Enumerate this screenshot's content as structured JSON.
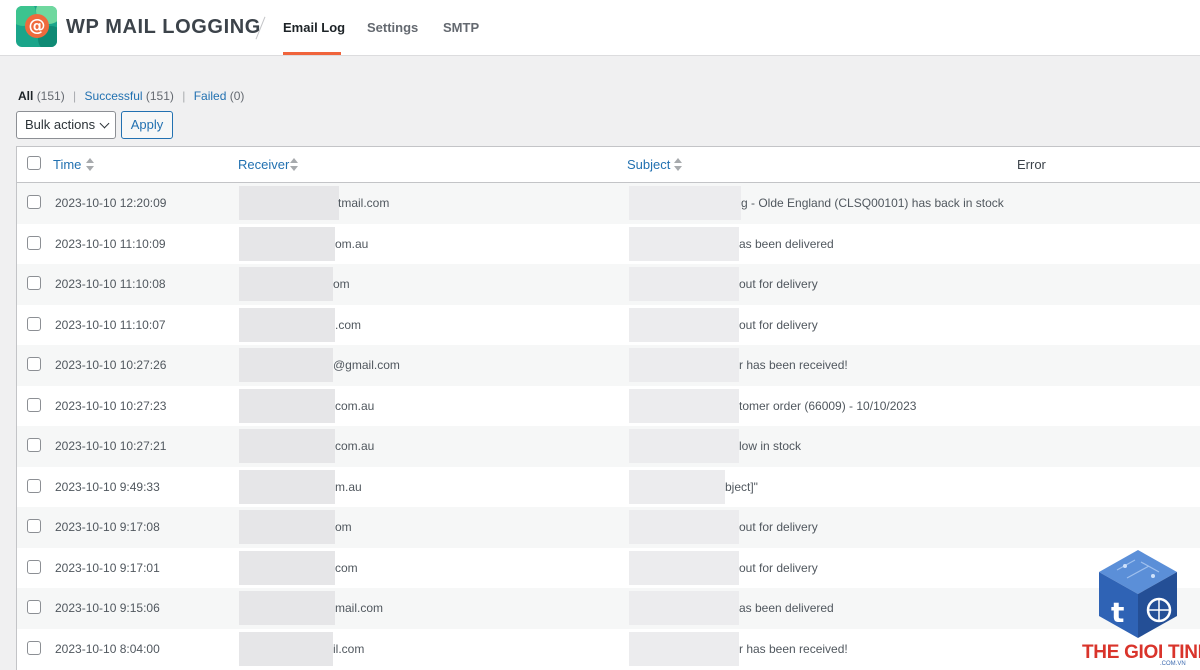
{
  "app": {
    "title": "WP MAIL LOGGING"
  },
  "tabs": [
    {
      "label": "Email Log",
      "active": true
    },
    {
      "label": "Settings",
      "active": false
    },
    {
      "label": "SMTP",
      "active": false
    }
  ],
  "views": {
    "all_label": "All",
    "all_count": "(151)",
    "successful_label": "Successful",
    "successful_count": "(151)",
    "failed_label": "Failed",
    "failed_count": "(0)"
  },
  "bulk": {
    "label": "Bulk actions",
    "apply_label": "Apply"
  },
  "table": {
    "columns": {
      "time": "Time",
      "receiver": "Receiver",
      "subject": "Subject",
      "error": "Error"
    },
    "rows": [
      {
        "time": "2023-10-10 12:20:09",
        "receiver": "tmail.com",
        "subject": "g - Olde England (CLSQ00101) has back in stock"
      },
      {
        "time": "2023-10-10 11:10:09",
        "receiver": "om.au",
        "subject": "as been delivered"
      },
      {
        "time": "2023-10-10 11:10:08",
        "receiver": "om",
        "subject": "out for delivery"
      },
      {
        "time": "2023-10-10 11:10:07",
        "receiver": ".com",
        "subject": "out for delivery"
      },
      {
        "time": "2023-10-10 10:27:26",
        "receiver": "@gmail.com",
        "subject": "r has been received!"
      },
      {
        "time": "2023-10-10 10:27:23",
        "receiver": "com.au",
        "subject": "tomer order (66009) - 10/10/2023"
      },
      {
        "time": "2023-10-10 10:27:21",
        "receiver": "com.au",
        "subject": "low in stock"
      },
      {
        "time": "2023-10-10 9:49:33",
        "receiver": "m.au",
        "subject": "bject]\""
      },
      {
        "time": "2023-10-10 9:17:08",
        "receiver": "om",
        "subject": "out for delivery"
      },
      {
        "time": "2023-10-10 9:17:01",
        "receiver": "com",
        "subject": "out for delivery"
      },
      {
        "time": "2023-10-10 9:15:06",
        "receiver": "mail.com",
        "subject": "as been delivered"
      },
      {
        "time": "2023-10-10 8:04:00",
        "receiver": "il.com",
        "subject": "r has been received!"
      }
    ]
  },
  "watermark": {
    "text": "THE GIOI TINHOC",
    "sub": ".COM.VN"
  },
  "colors": {
    "accent": "#f0643c",
    "link": "#2271b1",
    "watermark_red": "#d9342b",
    "watermark_blue": "#3d6bb0"
  }
}
